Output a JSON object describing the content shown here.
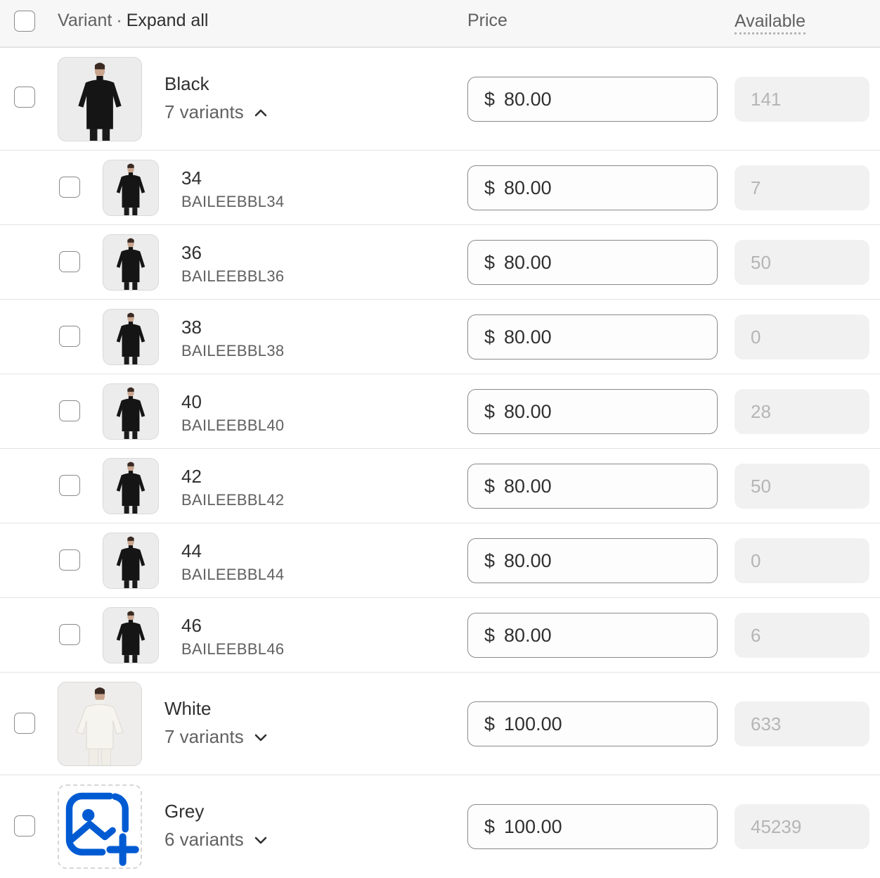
{
  "header": {
    "variant_label": "Variant",
    "separator": "·",
    "expand_all": "Expand all",
    "price": "Price",
    "available": "Available"
  },
  "currency_symbol": "$",
  "groups": [
    {
      "name": "Black",
      "variants_label": "7 variants",
      "expanded": true,
      "price": "80.00",
      "available": "141",
      "image": "black-top-photo"
    },
    {
      "name": "White",
      "variants_label": "7 variants",
      "expanded": false,
      "price": "100.00",
      "available": "633",
      "image": "white-top-photo"
    },
    {
      "name": "Grey",
      "variants_label": "6 variants",
      "expanded": false,
      "price": "100.00",
      "available": "45239",
      "image": "add-image-icon"
    }
  ],
  "black_variants": [
    {
      "size": "34",
      "sku": "BAILEEBBL34",
      "price": "80.00",
      "available": "7"
    },
    {
      "size": "36",
      "sku": "BAILEEBBL36",
      "price": "80.00",
      "available": "50"
    },
    {
      "size": "38",
      "sku": "BAILEEBBL38",
      "price": "80.00",
      "available": "0"
    },
    {
      "size": "40",
      "sku": "BAILEEBBL40",
      "price": "80.00",
      "available": "28"
    },
    {
      "size": "42",
      "sku": "BAILEEBBL42",
      "price": "80.00",
      "available": "50"
    },
    {
      "size": "44",
      "sku": "BAILEEBBL44",
      "price": "80.00",
      "available": "0"
    },
    {
      "size": "46",
      "sku": "BAILEEBBL46",
      "price": "80.00",
      "available": "6"
    }
  ],
  "colors": {
    "accent": "#005bd3",
    "border": "#e3e3e3",
    "header_bg": "#f7f7f7",
    "muted_text": "#616161",
    "disabled_text": "#b5b5b5"
  }
}
